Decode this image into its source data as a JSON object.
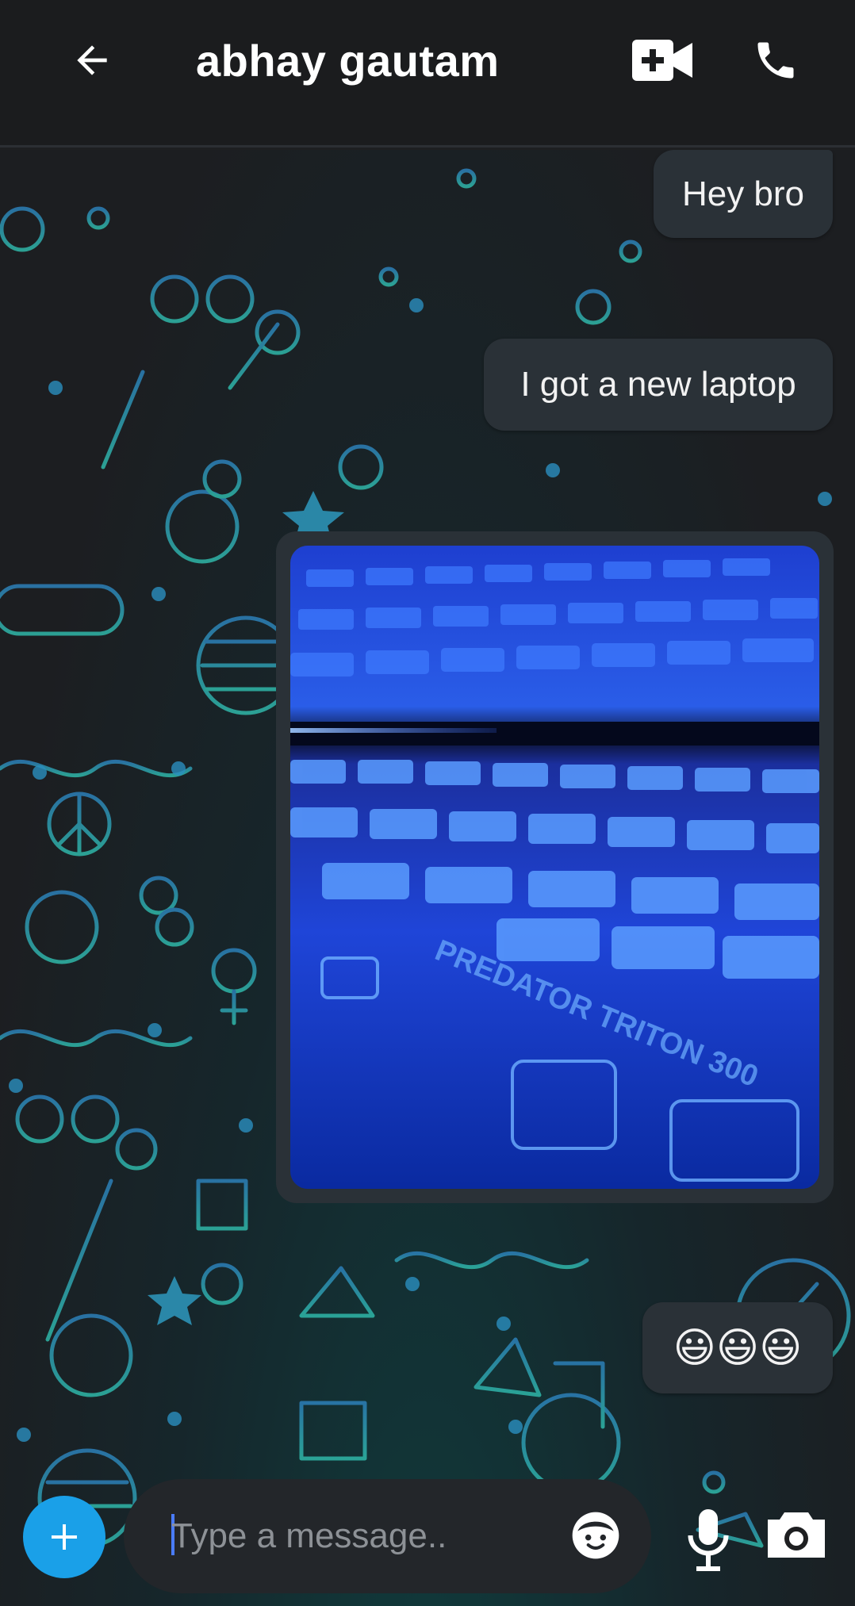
{
  "header": {
    "title": "abhay gautam",
    "back_icon": "arrow-left-icon",
    "video_icon": "video-call-icon",
    "call_icon": "phone-icon"
  },
  "messages": [
    {
      "type": "text",
      "text": "Hey bro"
    },
    {
      "type": "text",
      "text": "I got a new laptop"
    },
    {
      "type": "image",
      "caption_in_image": "PREDATOR TRITON 300"
    },
    {
      "type": "text",
      "text": "😃😃😃"
    }
  ],
  "composer": {
    "placeholder": "Type a message..",
    "plus_icon": "plus-icon",
    "emoji_icon": "emoji-face-icon",
    "mic_icon": "microphone-icon",
    "camera_icon": "camera-icon"
  },
  "colors": {
    "header_bg": "#1b1c1e",
    "bubble_bg": "#2a3137",
    "accent": "#1aa0e8",
    "doodle": "#2b8fbf"
  }
}
